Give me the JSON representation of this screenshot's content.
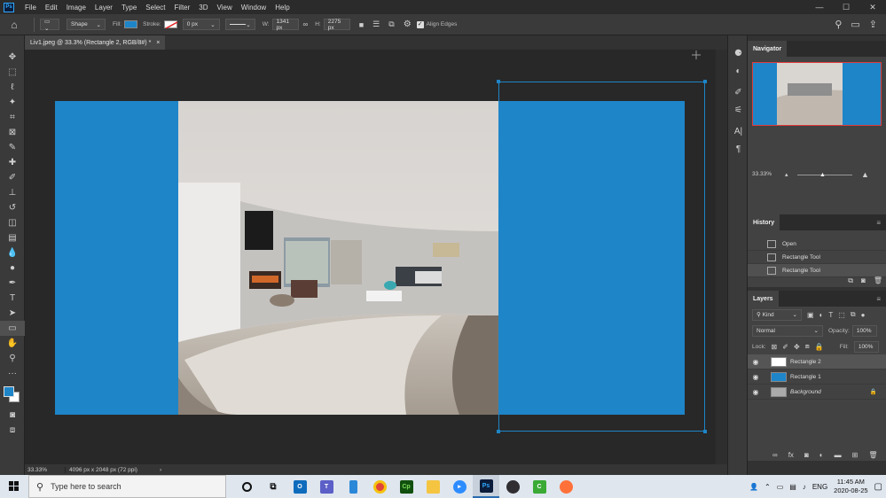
{
  "app": {
    "logo": "Ps",
    "menus": [
      "File",
      "Edit",
      "Image",
      "Layer",
      "Type",
      "Select",
      "Filter",
      "3D",
      "View",
      "Window",
      "Help"
    ]
  },
  "options": {
    "shape_mode": "Shape",
    "fill_label": "Fill:",
    "stroke_label": "Stroke:",
    "stroke_width": "0 px",
    "w_label": "W:",
    "w_value": "1341 px",
    "h_label": "H:",
    "h_value": "2275 px",
    "align_edges": "Align Edges",
    "fill_color": "#1e85c8"
  },
  "document": {
    "tab_title": "Liv1.jpeg @ 33.3% (Rectangle 2, RGB/8#) *",
    "close": "×",
    "zoom": "33.33%",
    "doc_info": "4096 px x 2048 px (72 ppi)",
    "shape_color": "#1e85c8"
  },
  "navigator": {
    "title": "Navigator",
    "zoom": "33.33%"
  },
  "history": {
    "title": "History",
    "items": [
      "Open",
      "Rectangle Tool",
      "Rectangle Tool"
    ]
  },
  "layers": {
    "title": "Layers",
    "kind": "Kind",
    "blend": "Normal",
    "opacity_label": "Opacity:",
    "opacity": "100%",
    "lock_label": "Lock:",
    "fill_label": "Fill:",
    "fill": "100%",
    "items": [
      "Rectangle 2",
      "Rectangle 1",
      "Background"
    ]
  },
  "taskbar": {
    "search_placeholder": "Type here to search",
    "time": "11:45 AM",
    "date": "2020-08-25",
    "lang": "ENG"
  }
}
